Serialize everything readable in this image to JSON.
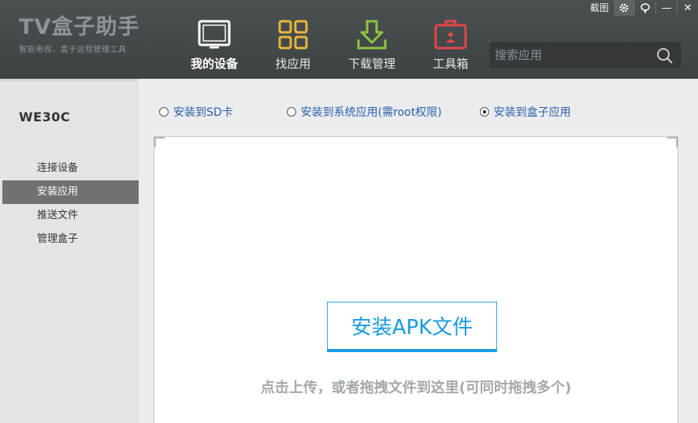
{
  "app": {
    "logo_title": "TV盒子助手",
    "logo_subtitle": "智能电视，盒子远程管理工具"
  },
  "window": {
    "screenshot_label": "截图",
    "gear_icon": "gear-icon",
    "chat_icon": "chat-icon",
    "minimize_label": "—",
    "close_label": "✕"
  },
  "nav": {
    "items": [
      {
        "label": "我的设备",
        "icon": "tablet-icon",
        "active": true
      },
      {
        "label": "找应用",
        "icon": "grid-icon",
        "active": false
      },
      {
        "label": "下载管理",
        "icon": "download-icon",
        "active": false
      },
      {
        "label": "工具箱",
        "icon": "toolbox-icon",
        "active": false
      }
    ]
  },
  "search": {
    "placeholder": "搜索应用",
    "value": ""
  },
  "sidebar": {
    "device_name": "WE30C",
    "items": [
      {
        "label": "连接设备",
        "active": false
      },
      {
        "label": "安装应用",
        "active": true
      },
      {
        "label": "推送文件",
        "active": false
      },
      {
        "label": "管理盒子",
        "active": false
      }
    ]
  },
  "install_options": {
    "items": [
      {
        "label": "安装到SD卡",
        "selected": false
      },
      {
        "label": "安装到系统应用(需root权限)",
        "selected": false
      },
      {
        "label": "安装到盒子应用",
        "selected": true
      }
    ]
  },
  "dropzone": {
    "button_label": "安装APK文件",
    "hint": "点击上传，或者拖拽文件到这里(可同时拖拽多个)"
  },
  "colors": {
    "header_bg": "#45494b",
    "accent_blue": "#1a9be0",
    "grid_icon_yellow": "#e8b53a",
    "download_icon_green": "#8cc63f",
    "toolbox_icon_red": "#e04848",
    "sidebar_active_bg": "#6e7274",
    "option_text": "#2b5fa8"
  }
}
